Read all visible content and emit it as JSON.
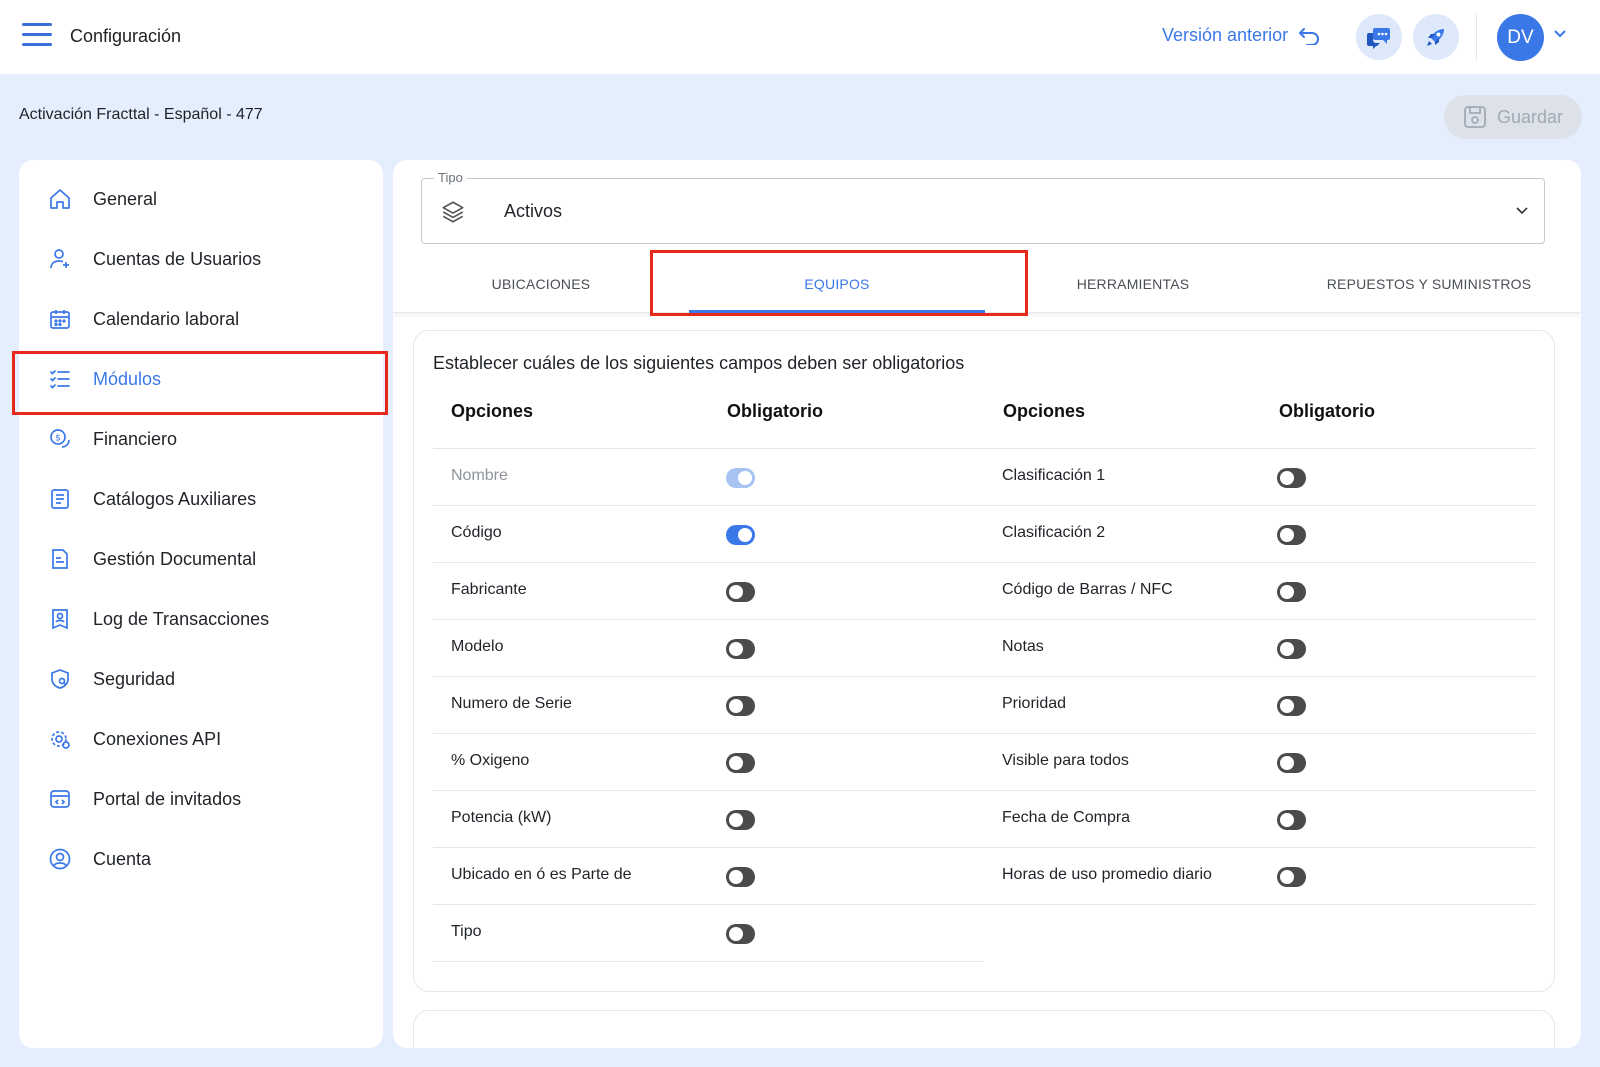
{
  "header": {
    "title": "Configuración",
    "prev_version_label": "Versión anterior",
    "avatar_initials": "DV"
  },
  "subheader": {
    "project_title": "Activación Fracttal - Español - 477",
    "save_label": "Guardar"
  },
  "sidebar": {
    "items": [
      {
        "label": "General",
        "icon": "home-icon"
      },
      {
        "label": "Cuentas de Usuarios",
        "icon": "user-add-icon"
      },
      {
        "label": "Calendario laboral",
        "icon": "calendar-icon"
      },
      {
        "label": "Módulos",
        "icon": "checklist-icon",
        "active": true
      },
      {
        "label": "Financiero",
        "icon": "coin-icon"
      },
      {
        "label": "Catálogos Auxiliares",
        "icon": "catalog-icon"
      },
      {
        "label": "Gestión Documental",
        "icon": "document-icon"
      },
      {
        "label": "Log de Transacciones",
        "icon": "log-icon"
      },
      {
        "label": "Seguridad",
        "icon": "shield-icon"
      },
      {
        "label": "Conexiones API",
        "icon": "api-gear-icon"
      },
      {
        "label": "Portal de invitados",
        "icon": "portal-icon"
      },
      {
        "label": "Cuenta",
        "icon": "account-icon"
      }
    ]
  },
  "tipo": {
    "legend": "Tipo",
    "value": "Activos"
  },
  "tabs": [
    {
      "label": "UBICACIONES"
    },
    {
      "label": "EQUIPOS",
      "active": true
    },
    {
      "label": "HERRAMIENTAS"
    },
    {
      "label": "REPUESTOS Y SUMINISTROS"
    }
  ],
  "fields_card": {
    "title": "Establecer cuáles de los siguientes campos deben ser obligatorios",
    "col_options": "Opciones",
    "col_required": "Obligatorio",
    "left": [
      {
        "label": "Nombre",
        "state": "disabled-on"
      },
      {
        "label": "Código",
        "state": "on"
      },
      {
        "label": "Fabricante",
        "state": "off"
      },
      {
        "label": "Modelo",
        "state": "off"
      },
      {
        "label": "Numero de Serie",
        "state": "off"
      },
      {
        "label": "% Oxigeno",
        "state": "off"
      },
      {
        "label": "Potencia (kW)",
        "state": "off"
      },
      {
        "label": "Ubicado en ó es Parte de",
        "state": "off"
      },
      {
        "label": "Tipo",
        "state": "off"
      }
    ],
    "right": [
      {
        "label": "Clasificación 1",
        "state": "off"
      },
      {
        "label": "Clasificación 2",
        "state": "off"
      },
      {
        "label": "Código de Barras / NFC",
        "state": "off"
      },
      {
        "label": "Notas",
        "state": "off"
      },
      {
        "label": "Prioridad",
        "state": "off"
      },
      {
        "label": "Visible para todos",
        "state": "off"
      },
      {
        "label": "Fecha de Compra",
        "state": "off"
      },
      {
        "label": "Horas de uso promedio diario",
        "state": "off"
      }
    ]
  },
  "colors": {
    "accent": "#3b78e7",
    "highlight": "#e8281c",
    "background": "#e5eefc"
  }
}
